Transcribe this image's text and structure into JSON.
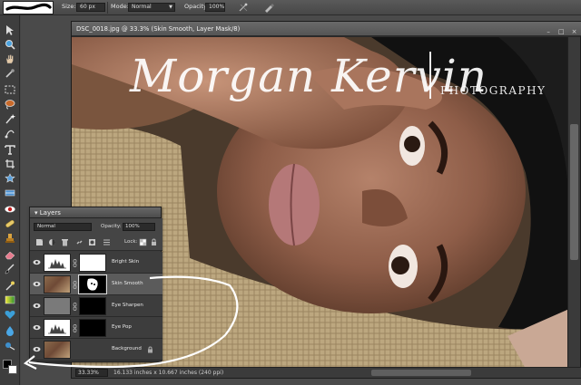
{
  "options_bar": {
    "size_label": "Size:",
    "size_value": "60 px",
    "mode_label": "Mode:",
    "mode_value": "Normal",
    "opacity_label": "Opacity:",
    "opacity_value": "100%"
  },
  "document": {
    "title": "DSC_0018.jpg @ 33.3% (Skin Smooth, Layer Mask/8)",
    "zoom": "33.33%",
    "info": "16.133 inches x 10.667 inches (240 ppi)"
  },
  "watermark": {
    "name": "Morgan Kervin",
    "subtitle": "PHOTOGRAPHY"
  },
  "layers_panel": {
    "title": "Layers",
    "blend_mode": "Normal",
    "opacity_label": "Opacity:",
    "opacity_value": "100%",
    "lock_label": "Lock:",
    "layers": [
      {
        "name": "Bright Skin",
        "thumb": "levels",
        "mask": "white",
        "selected": false,
        "locked": false
      },
      {
        "name": "Skin Smooth",
        "thumb": "photo",
        "mask": "face",
        "selected": true,
        "locked": false
      },
      {
        "name": "Eye Sharpen",
        "thumb": "gray",
        "mask": "black",
        "selected": false,
        "locked": false
      },
      {
        "name": "Eye Pop",
        "thumb": "levels",
        "mask": "black",
        "selected": false,
        "locked": false
      },
      {
        "name": "Background",
        "thumb": "photo",
        "mask": "none",
        "selected": false,
        "locked": true
      }
    ]
  },
  "colors": {
    "foreground": "#000000",
    "background": "#ffffff"
  }
}
